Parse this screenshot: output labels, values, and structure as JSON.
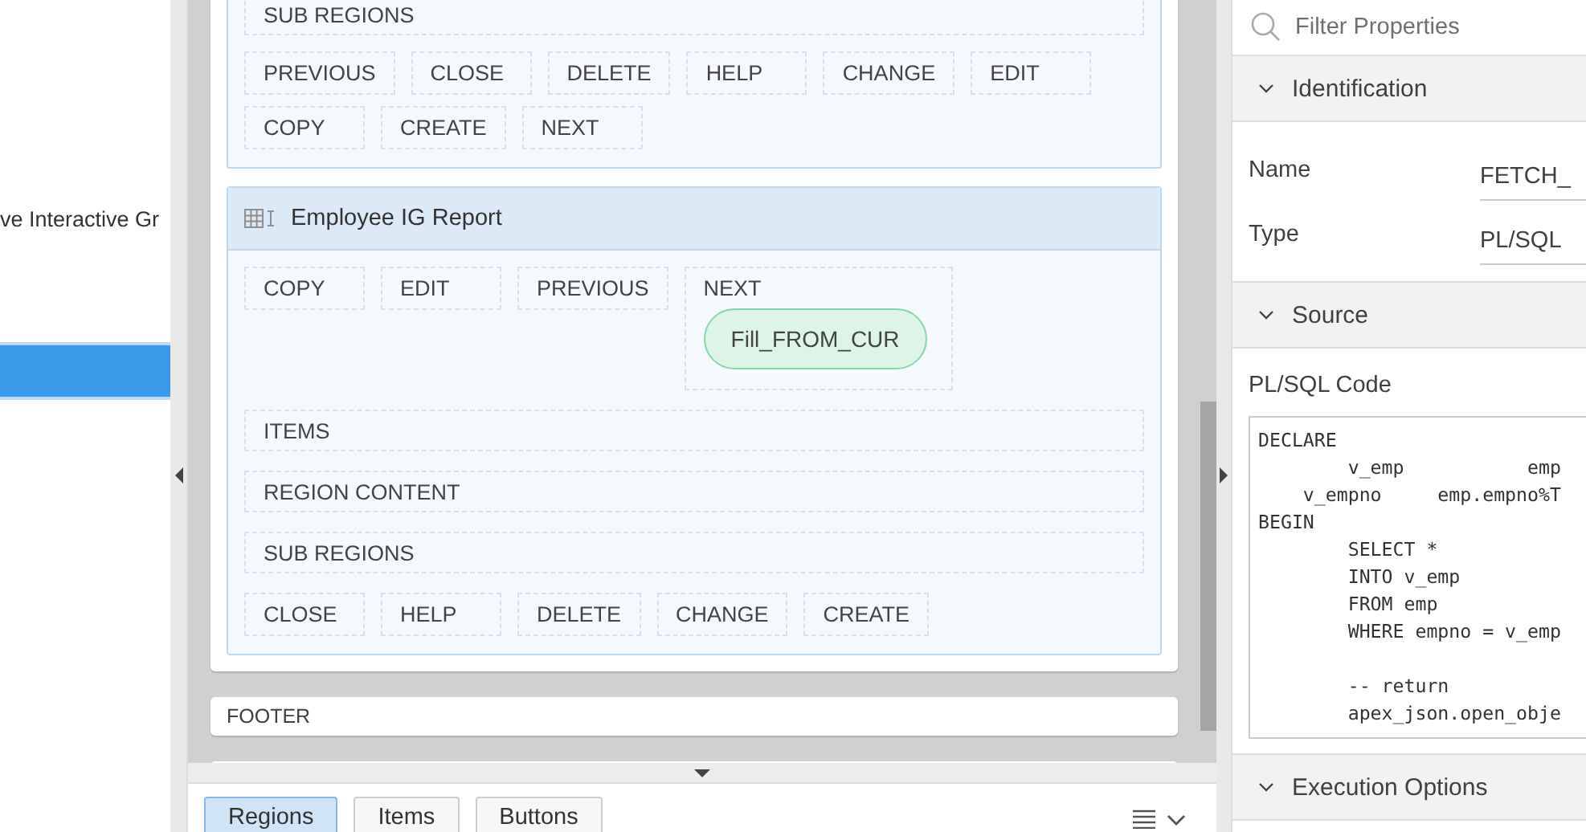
{
  "left_tree": {
    "items": [
      {
        "label": "ve Interactive Gr",
        "selected": false
      },
      {
        "selected": true
      }
    ]
  },
  "layout": {
    "regions": [
      {
        "kind": "continued",
        "slots": [
          "SUB REGIONS"
        ],
        "button_slots": [
          {
            "label": "PREVIOUS"
          },
          {
            "label": "CLOSE"
          },
          {
            "label": "DELETE"
          },
          {
            "label": "HELP"
          },
          {
            "label": "CHANGE"
          },
          {
            "label": "EDIT"
          },
          {
            "label": "COPY"
          },
          {
            "label": "CREATE"
          },
          {
            "label": "NEXT"
          }
        ]
      },
      {
        "kind": "region",
        "title": "Employee IG Report",
        "button_slots": [
          {
            "label": "COPY"
          },
          {
            "label": "EDIT"
          },
          {
            "label": "PREVIOUS"
          },
          {
            "label": "NEXT",
            "items": [
              "Fill_FROM_CUR"
            ]
          }
        ],
        "slots": [
          "ITEMS",
          "REGION CONTENT",
          "SUB REGIONS"
        ],
        "bottom_button_slots": [
          {
            "label": "CLOSE"
          },
          {
            "label": "HELP"
          },
          {
            "label": "DELETE"
          },
          {
            "label": "CHANGE"
          },
          {
            "label": "CREATE"
          }
        ]
      }
    ],
    "footer": "FOOTER"
  },
  "bottom_tabs": [
    {
      "label": "Regions",
      "selected": true
    },
    {
      "label": "Items",
      "selected": false
    },
    {
      "label": "Buttons",
      "selected": false
    }
  ],
  "property_editor": {
    "search": {
      "placeholder": "Filter Properties"
    },
    "groups": [
      {
        "title": "Identification",
        "expanded": true,
        "properties": [
          {
            "kind": "field",
            "label": "Name",
            "value": "FETCH_"
          },
          {
            "kind": "field",
            "label": "Type",
            "value": "PL/SQL"
          }
        ]
      },
      {
        "title": "Source",
        "expanded": true,
        "properties": [
          {
            "kind": "code",
            "label": "PL/SQL Code",
            "code": "DECLARE\n        v_emp           emp\n    v_empno     emp.empno%T\nBEGIN\n        SELECT *\n        INTO v_emp\n        FROM emp\n        WHERE empno = v_emp\n\n        -- return\n        apex_json.open_obje"
          }
        ]
      },
      {
        "title": "Execution Options",
        "expanded": true
      }
    ]
  }
}
